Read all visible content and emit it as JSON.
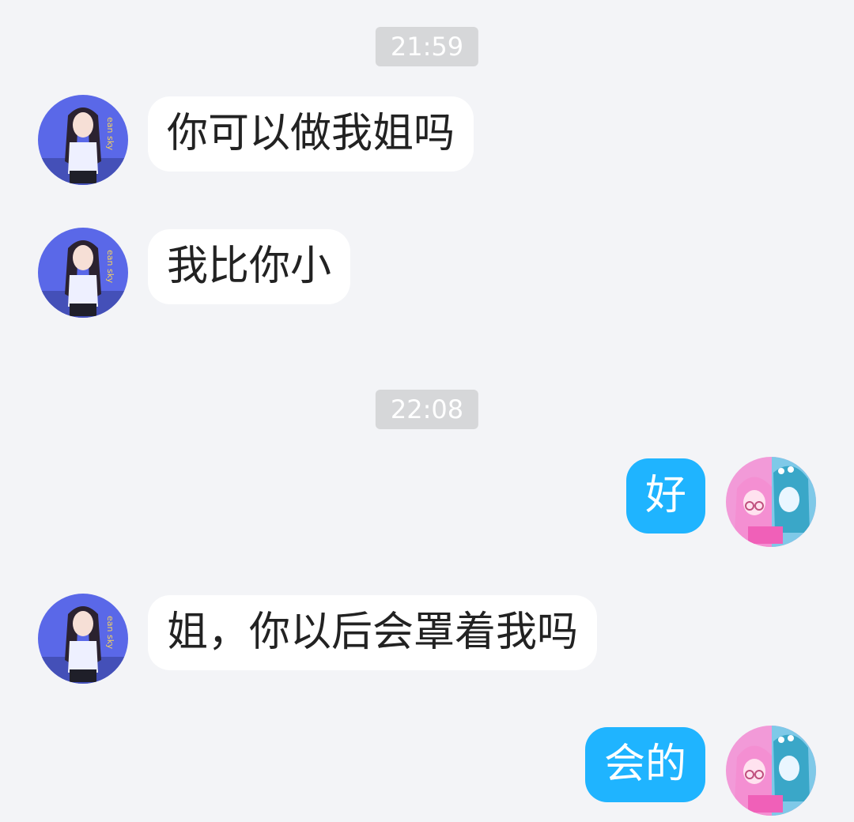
{
  "conversation": {
    "timestamps": [
      "21:59",
      "22:08"
    ],
    "messages": [
      {
        "sender": "contact",
        "text": "你可以做我姐吗",
        "avatar": "anime-girl-blue-avatar"
      },
      {
        "sender": "contact",
        "text": "我比你小",
        "avatar": "anime-girl-blue-avatar"
      },
      {
        "sender": "me",
        "text": "好",
        "avatar": "anime-duo-pink-avatar"
      },
      {
        "sender": "contact",
        "text": "姐，你以后会罩着我吗",
        "avatar": "anime-girl-blue-avatar"
      },
      {
        "sender": "me",
        "text": "会的",
        "avatar": "anime-duo-pink-avatar"
      }
    ]
  },
  "colors": {
    "background": "#f3f4f7",
    "incoming_bubble": "#ffffff",
    "outgoing_bubble": "#1fb4ff",
    "timestamp_bg": "#d6d7d9"
  }
}
